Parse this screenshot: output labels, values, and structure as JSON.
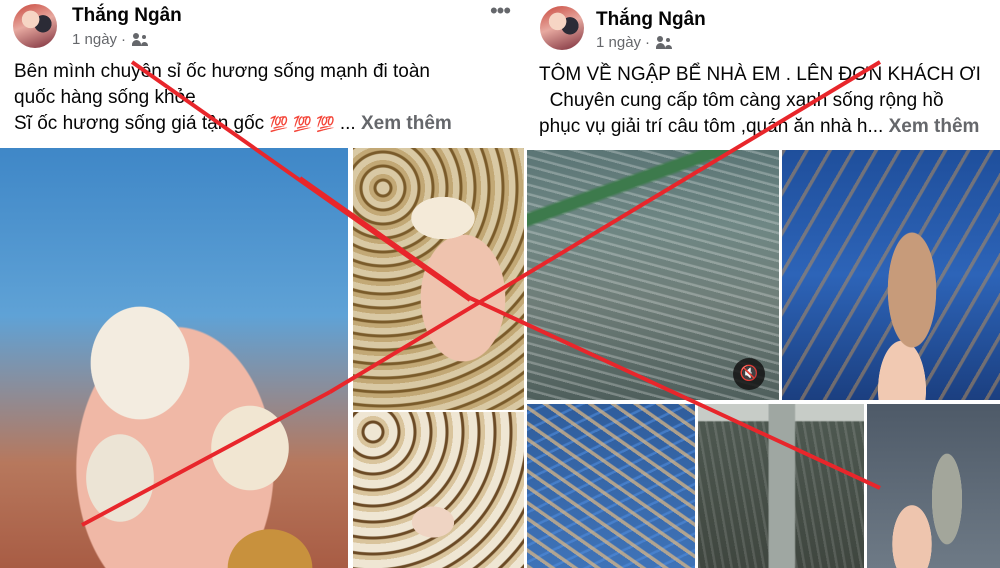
{
  "posts": [
    {
      "author": "Thắng Ngân",
      "time": "1 ngày",
      "separator": "·",
      "more_icon": "more-horizontal-icon",
      "audience_icon": "friends-icon",
      "text_lines": [
        "Bên  mình chuyên sỉ ốc hương sống mạnh đi toàn",
        "quốc hàng sống khỏe",
        "Sĩ ốc hương sống giá tận gốc"
      ],
      "emoji": [
        "💯",
        "💯",
        "💯"
      ],
      "ellipsis": "...",
      "see_more": "Xem thêm",
      "photos": [
        "snail-photo-large",
        "snail-in-hand-photo",
        "snail-pile-photo"
      ]
    },
    {
      "author": "Thắng Ngân",
      "time": "1 ngày",
      "separator": "·",
      "audience_icon": "friends-icon",
      "text_lines": [
        "TÔM VỀ NGẬP BỂ NHÀ EM . LÊN ĐƠN KHÁCH ƠI",
        "Chuyên cung cấp tôm càng xanh sống rộng hồ",
        "phục vụ giải trí câu tôm ,quán ăn nhà h..."
      ],
      "see_more": "Xem thêm",
      "mute_icon": "speaker-muted-icon",
      "photos": [
        "shrimp-tank-video",
        "shrimp-blue-tank-photo",
        "shrimp-crowd-photo",
        "shrimp-pond-photo",
        "shrimp-in-hand-photo"
      ]
    }
  ],
  "overlay": {
    "cross_color": "#e8262b"
  }
}
